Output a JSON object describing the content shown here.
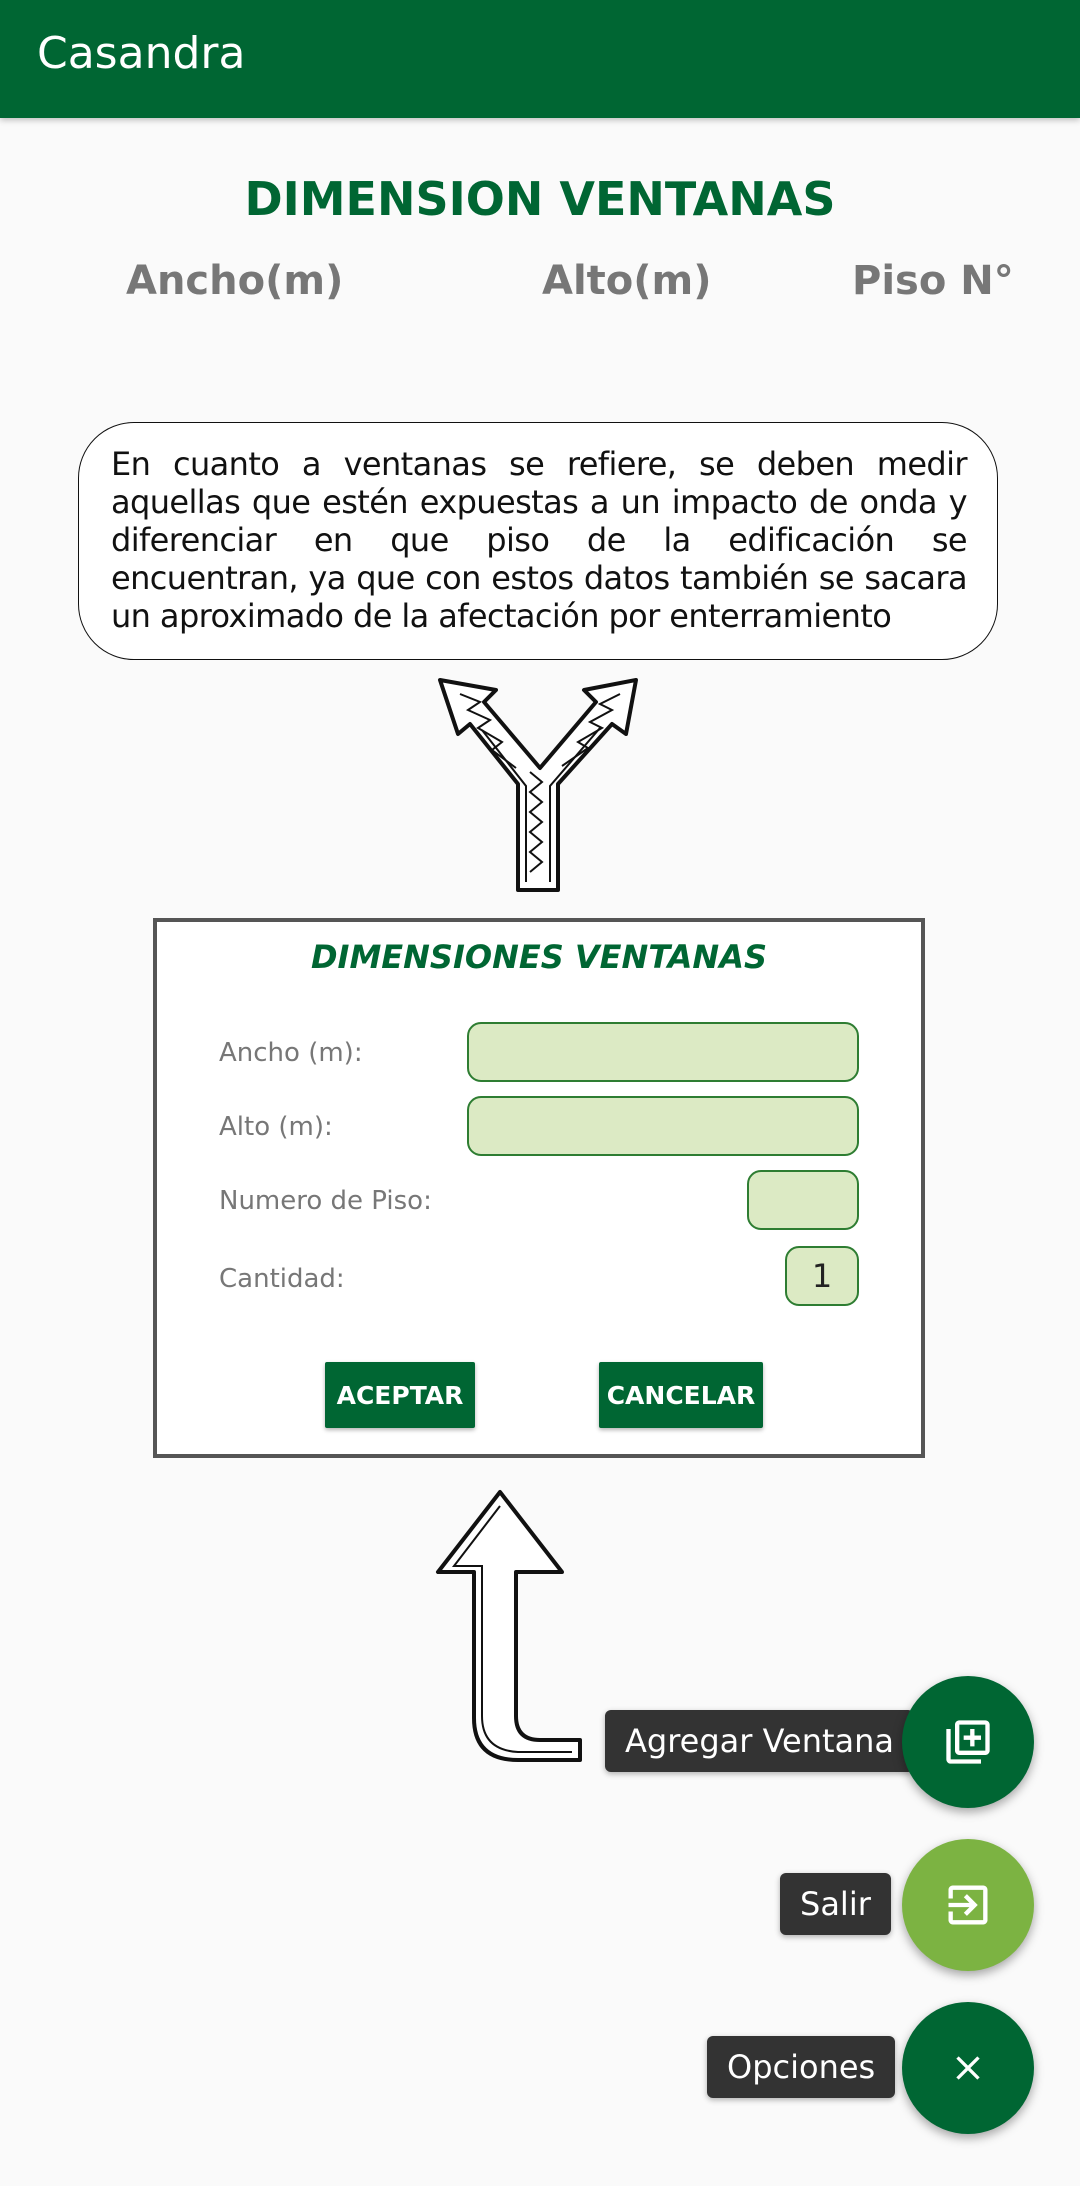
{
  "appbar": {
    "title": "Casandra"
  },
  "page": {
    "title": "DIMENSION VENTANAS",
    "columns": [
      "Ancho(m)",
      "Alto(m)",
      "Piso N°"
    ]
  },
  "info": {
    "text": "En cuanto a ventanas se refiere, se deben medir aquellas que estén expuestas a un impacto de onda y diferenciar en que piso de la edificación se encuentran, ya que con estos datos también se sacara un aproximado de la afectación por enterramiento"
  },
  "dialog": {
    "title": "DIMENSIONES VENTANAS",
    "ancho_label": "Ancho (m):",
    "ancho_value": "",
    "alto_label": "Alto (m):",
    "alto_value": "",
    "piso_label": "Numero de Piso:",
    "piso_value": "",
    "cantidad_label": "Cantidad:",
    "cantidad_value": "1",
    "accept_label": "ACEPTAR",
    "cancel_label": "CANCELAR"
  },
  "fabs": {
    "add_label": "Agregar Ventana",
    "exit_label": "Salir",
    "options_label": "Opciones",
    "add_icon": "add-box-icon",
    "exit_icon": "exit-icon",
    "close_icon": "close-icon"
  },
  "colors": {
    "primary": "#006633",
    "exit_fab": "#7cb342",
    "field_bg": "#dceac4"
  }
}
